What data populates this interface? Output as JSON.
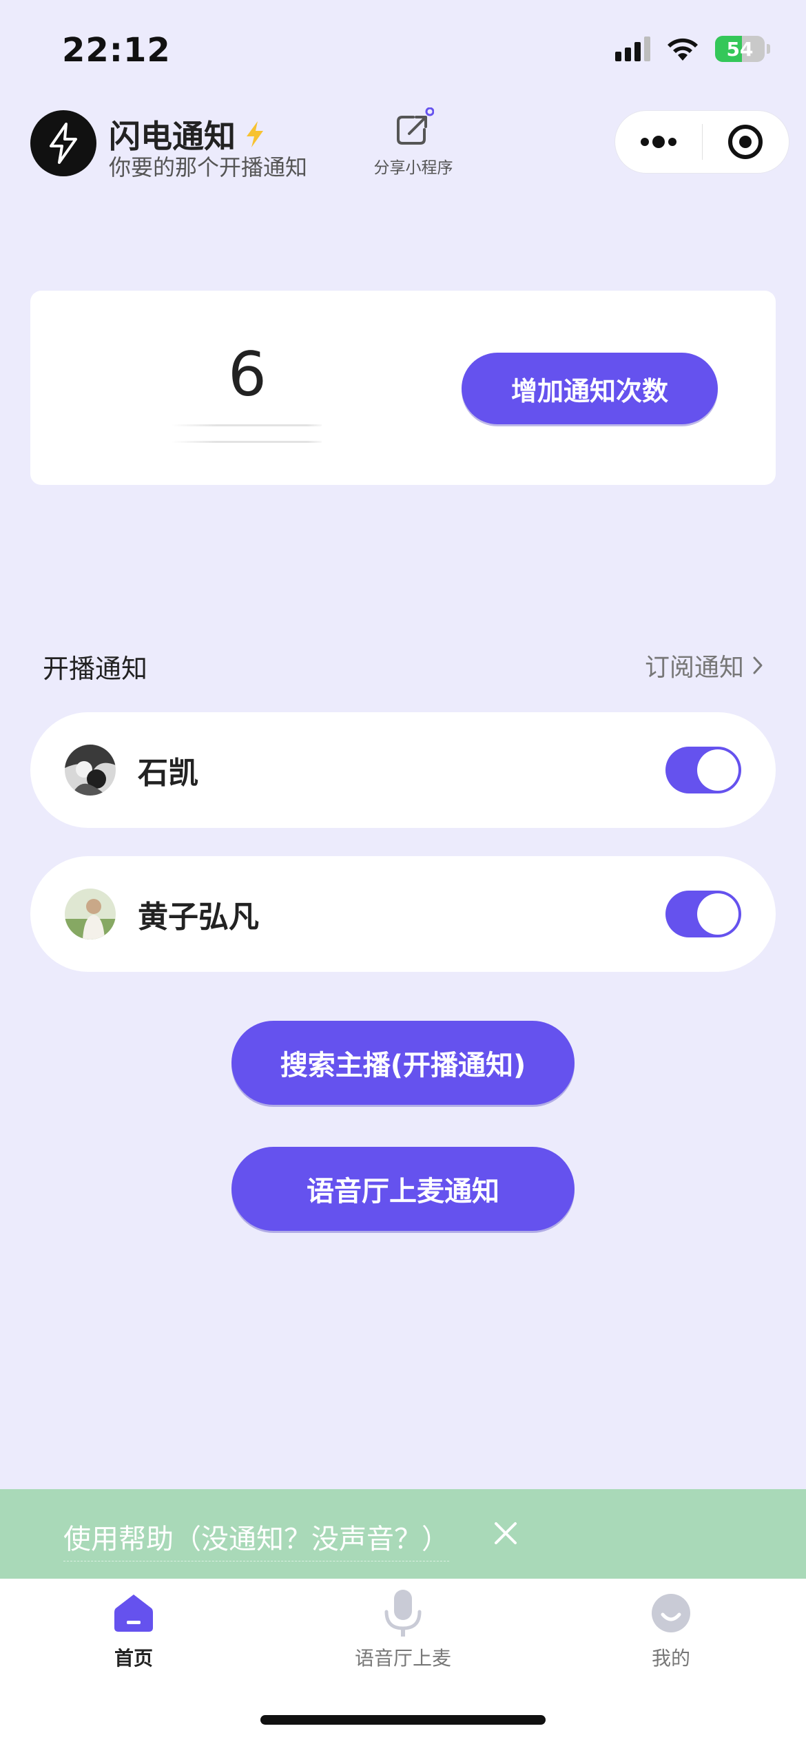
{
  "status_bar": {
    "time": "22:12",
    "battery": "54",
    "battery_level": 0.54
  },
  "header": {
    "app_name": "闪电通知",
    "tagline": "你要的那个开播通知",
    "share_label": "分享小程序"
  },
  "count_card": {
    "count": "6",
    "add_button": "增加通知次数"
  },
  "section": {
    "title": "开播通知",
    "subscribe_link": "订阅通知"
  },
  "anchors": [
    {
      "name": "石凯",
      "enabled": true
    },
    {
      "name": "黄子弘凡",
      "enabled": true
    }
  ],
  "actions": {
    "search_button": "搜索主播(开播通知)",
    "voice_button": "语音厅上麦通知"
  },
  "help_bar": {
    "text": "使用帮助（没通知？没声音？）"
  },
  "tabs": [
    {
      "label": "首页",
      "icon": "home-icon",
      "active": true
    },
    {
      "label": "语音厅上麦",
      "icon": "microphone-icon",
      "active": false
    },
    {
      "label": "我的",
      "icon": "profile-icon",
      "active": false
    }
  ],
  "colors": {
    "accent": "#6552EE",
    "background": "#ECEBFC",
    "help_bar": "#A9D9B8"
  }
}
